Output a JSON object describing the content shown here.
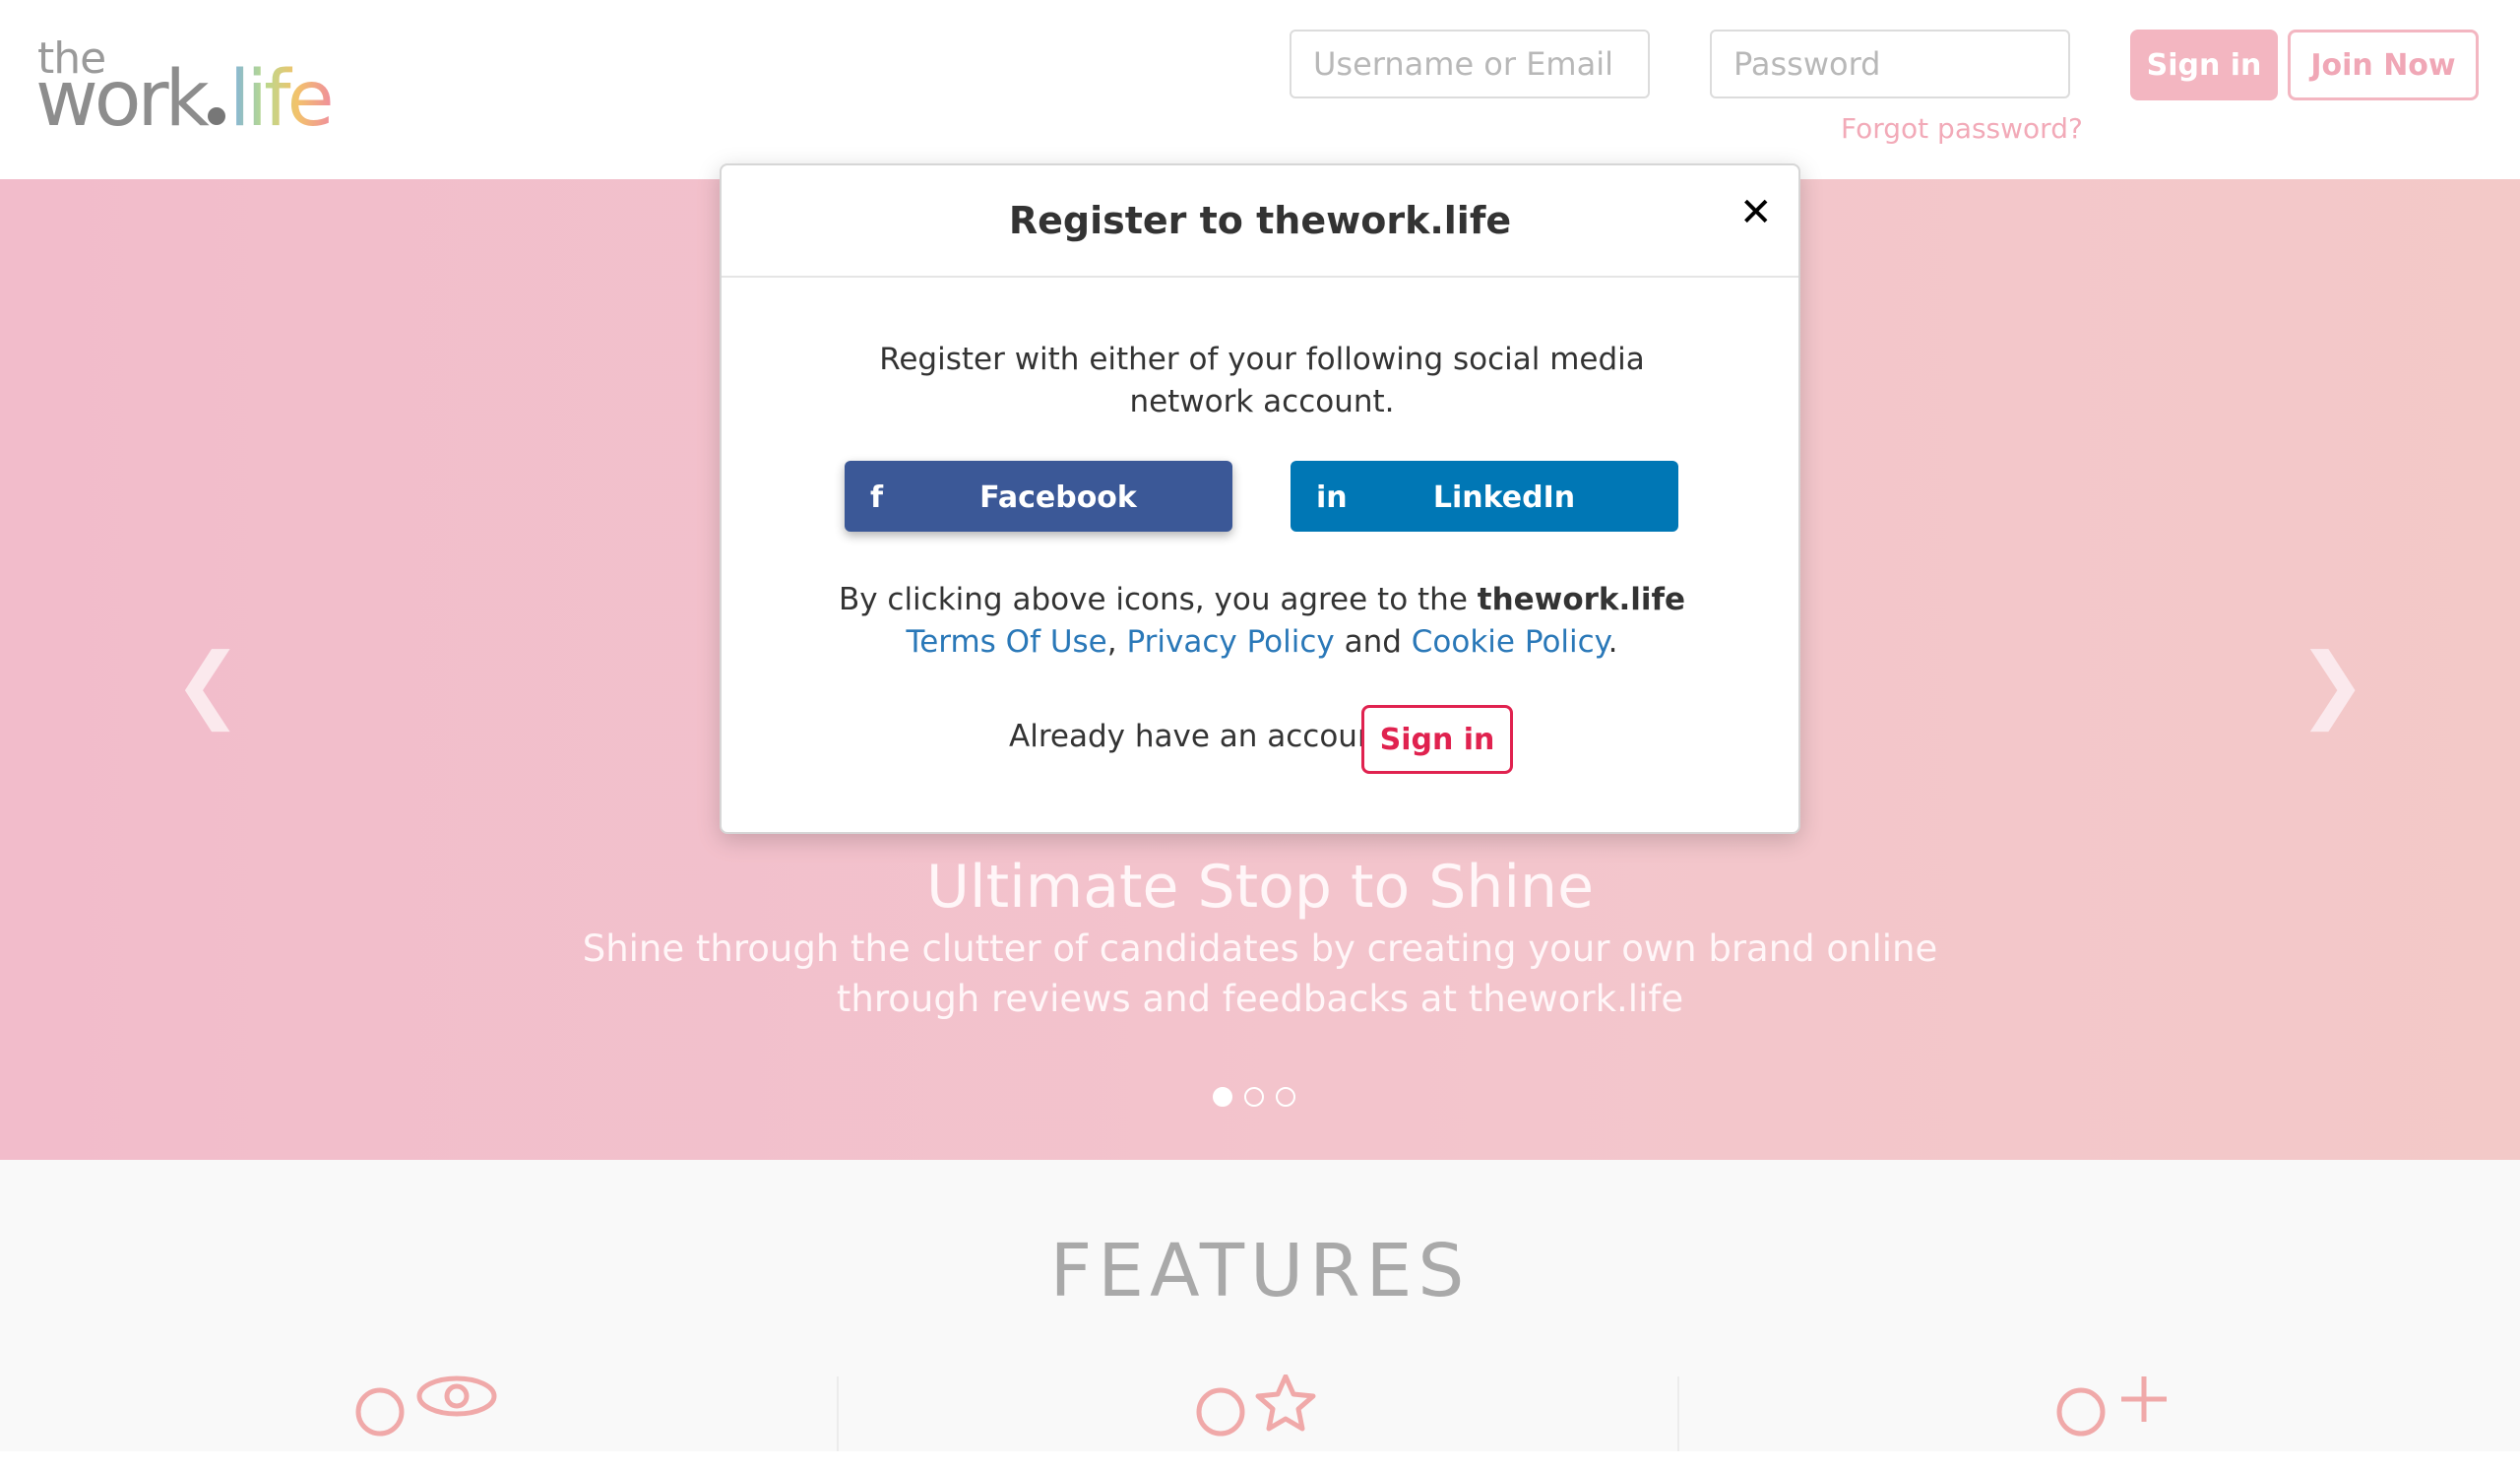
{
  "header": {
    "logo_the": "the",
    "logo_work": "work",
    "logo_life": "life",
    "username_placeholder": "Username or Email",
    "password_placeholder": "Password",
    "signin_label": "Sign in",
    "join_label": "Join Now",
    "forgot_label": "Forgot password?"
  },
  "hero": {
    "title": "Ultimate Stop to Shine",
    "subtitle": "Shine through the clutter of candidates by creating your own brand online through reviews and feedbacks at thework.life",
    "prev_icon": "chevron-left-icon",
    "next_icon": "chevron-right-icon",
    "slide_count": 3,
    "active_slide": 1
  },
  "features": {
    "title": "FEATURES",
    "icons": [
      "user-eye-icon",
      "user-star-icon",
      "user-plus-icon"
    ]
  },
  "modal": {
    "title": "Register to thework.life",
    "close_icon": "close-icon",
    "intro": "Register with either of your following social media network account.",
    "facebook_label": "Facebook",
    "facebook_icon": "f",
    "linkedin_label": "LinkedIn",
    "linkedin_icon": "in",
    "agree_prefix": "By clicking above icons, you agree to the ",
    "agree_brand": "thework.life",
    "terms_label": "Terms Of Use",
    "comma": ", ",
    "privacy_label": "Privacy Policy",
    "and": " and ",
    "cookie_label": "Cookie Policy",
    "period": ".",
    "already_label": "Already have an account?",
    "signin_label": "Sign in"
  },
  "colors": {
    "facebook": "#3b5897",
    "linkedin": "#0077b5",
    "accent": "#e0224f",
    "link": "#2a78b8",
    "hero_bg": "#f2bccb"
  }
}
